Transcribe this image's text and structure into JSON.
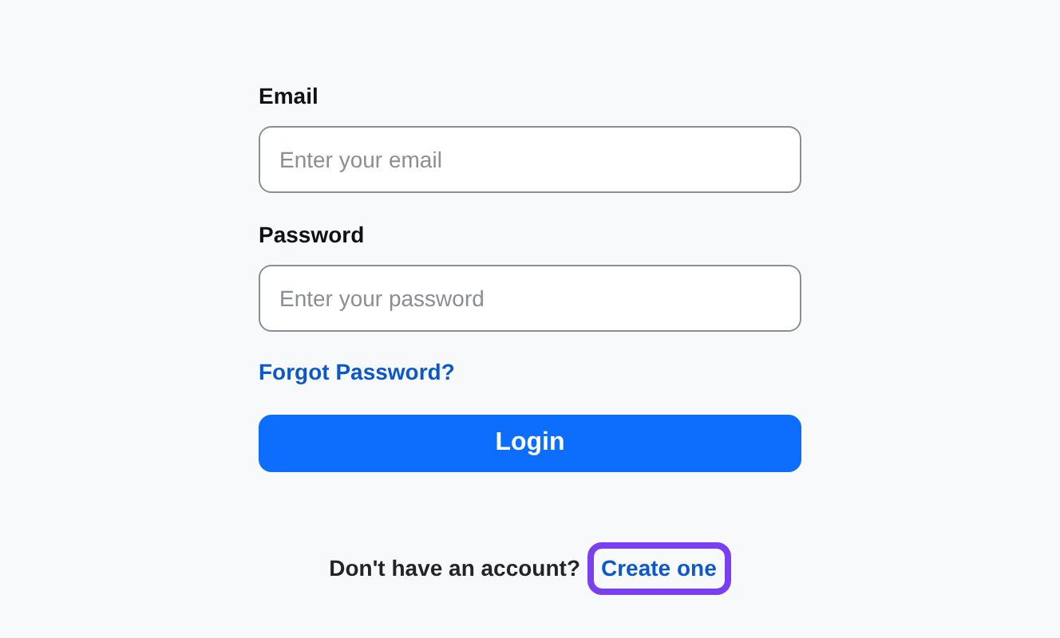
{
  "form": {
    "fields": [
      {
        "label": "Email",
        "placeholder": "Enter your email"
      },
      {
        "label": "Password",
        "placeholder": "Enter your password"
      }
    ],
    "forgot_link": "Forgot Password?",
    "submit": "Login"
  },
  "signup": {
    "prompt": "Don't have an account?",
    "link": "Create one",
    "highlighted": true
  }
}
